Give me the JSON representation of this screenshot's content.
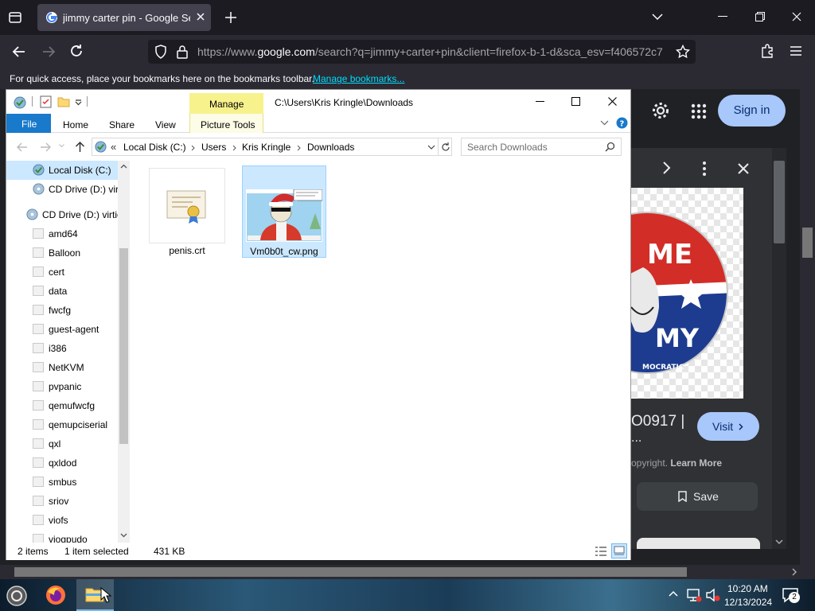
{
  "browser": {
    "tab_title": "jimmy carter pin - Google Search",
    "url_prefix": "https://www.",
    "url_domain": "google.com",
    "url_rest": "/search?q=jimmy+carter+pin&client=firefox-b-1-d&sca_esv=f406572c7",
    "bookmarks_message": "For quick access, place your bookmarks here on the bookmarks toolbar.",
    "manage_bookmarks_link": "Manage bookmarks..."
  },
  "google": {
    "sign_in_label": "Sign in",
    "result_title": "O0917 |",
    "result_ellipsis": "...",
    "copyright_text": "opyright.",
    "learn_more_label": "Learn More",
    "visit_label": "Visit",
    "save_label": "Save",
    "pin_text_top": "ME",
    "pin_text_bottom": "MY",
    "pin_text_small": "MOCRATIC"
  },
  "explorer": {
    "window_title": "C:\\Users\\Kris Kringle\\Downloads",
    "contextual_tab": "Manage",
    "tabs": [
      "File",
      "Home",
      "Share",
      "View",
      "Picture Tools"
    ],
    "breadcrumb": [
      "Local Disk (C:)",
      "Users",
      "Kris Kringle",
      "Downloads"
    ],
    "breadcrumb_prefix": "«",
    "search_placeholder": "Search Downloads",
    "nav_items": [
      {
        "label": "Local Disk (C:)",
        "icon": "drive-icon",
        "selected": true
      },
      {
        "label": "CD Drive (D:) virtio-win",
        "icon": "cd-drive-icon"
      },
      {
        "label": "CD Drive (D:) virtio-win",
        "icon": "cd-drive-icon"
      },
      {
        "label": "amd64",
        "icon": "folder-icon"
      },
      {
        "label": "Balloon",
        "icon": "folder-icon"
      },
      {
        "label": "cert",
        "icon": "folder-icon"
      },
      {
        "label": "data",
        "icon": "folder-icon"
      },
      {
        "label": "fwcfg",
        "icon": "folder-icon"
      },
      {
        "label": "guest-agent",
        "icon": "folder-icon"
      },
      {
        "label": "i386",
        "icon": "folder-icon"
      },
      {
        "label": "NetKVM",
        "icon": "folder-icon"
      },
      {
        "label": "pvpanic",
        "icon": "folder-icon"
      },
      {
        "label": "qemufwcfg",
        "icon": "folder-icon"
      },
      {
        "label": "qemupciserial",
        "icon": "folder-icon"
      },
      {
        "label": "qxl",
        "icon": "folder-icon"
      },
      {
        "label": "qxldod",
        "icon": "folder-icon"
      },
      {
        "label": "smbus",
        "icon": "folder-icon"
      },
      {
        "label": "sriov",
        "icon": "folder-icon"
      },
      {
        "label": "viofs",
        "icon": "folder-icon"
      },
      {
        "label": "viogpudo",
        "icon": "folder-icon"
      }
    ],
    "files": [
      {
        "name": "penis.crt",
        "icon": "certificate-icon",
        "selected": false
      },
      {
        "name": "Vm0b0t_cw.png",
        "icon": "image-thumbnail-icon",
        "selected": true
      }
    ],
    "status_count": "2 items",
    "status_selected": "1 item selected",
    "status_size": "431 KB"
  },
  "taskbar": {
    "time": "10:20 AM",
    "date": "12/13/2024",
    "notification_count": "2"
  },
  "colors": {
    "ribbon_file_blue": "#1979ca",
    "manage_yellow": "#f8f28d",
    "selection_blue": "#cce8ff",
    "google_sign_in": "#a8c7fa",
    "pin_red": "#d32d27",
    "pin_blue": "#1d3c8f"
  }
}
